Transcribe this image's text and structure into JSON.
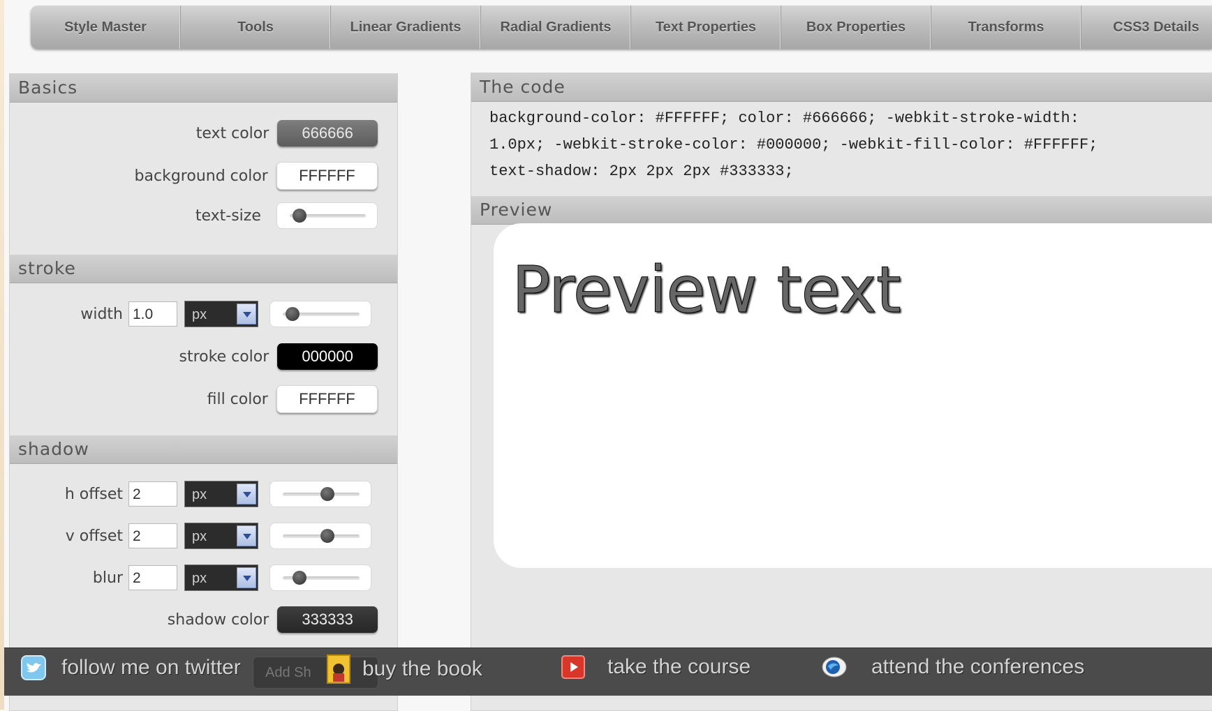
{
  "nav": {
    "tabs": [
      "Style Master",
      "Tools",
      "Linear Gradients",
      "Radial Gradients",
      "Text Properties",
      "Box Properties",
      "Transforms",
      "CSS3 Details"
    ]
  },
  "basics": {
    "heading": "Basics",
    "text_color_label": "text color",
    "text_color_value": "666666",
    "bg_color_label": "background color",
    "bg_color_value": "FFFFFF",
    "text_size_label": "text-size",
    "text_size_level": 0.1
  },
  "stroke": {
    "heading": "stroke",
    "width_label": "width",
    "width_value": "1.0",
    "width_unit": "px",
    "width_level": 0.1,
    "stroke_color_label": "stroke color",
    "stroke_color_value": "000000",
    "fill_color_label": "fill color",
    "fill_color_value": "FFFFFF"
  },
  "shadow": {
    "heading": "shadow",
    "h_label": "h offset",
    "h_value": "2",
    "h_unit": "px",
    "h_level": 0.6,
    "v_label": "v offset",
    "v_value": "2",
    "v_unit": "px",
    "v_level": 0.6,
    "blur_label": "blur",
    "blur_value": "2",
    "blur_unit": "px",
    "blur_level": 0.2,
    "shadow_color_label": "shadow color",
    "shadow_color_value": "333333"
  },
  "code": {
    "heading": "The code",
    "line1": "background-color: #FFFFFF; color: #666666; -webkit-stroke-width:",
    "line2": "1.0px; -webkit-stroke-color: #000000; -webkit-fill-color: #FFFFFF;",
    "line3": "text-shadow: 2px 2px 2px #333333;"
  },
  "preview": {
    "heading": "Preview",
    "text": "Preview text"
  },
  "footer": {
    "twitter": "follow me on twitter",
    "addthis": "Add Sh",
    "book": "buy the book",
    "course": "take the course",
    "conferences": "attend the conferences"
  },
  "icons": {
    "twitter": "twitter-bird-icon",
    "book": "book-cover-icon",
    "course": "play-video-icon",
    "conferences": "globe-icon"
  }
}
